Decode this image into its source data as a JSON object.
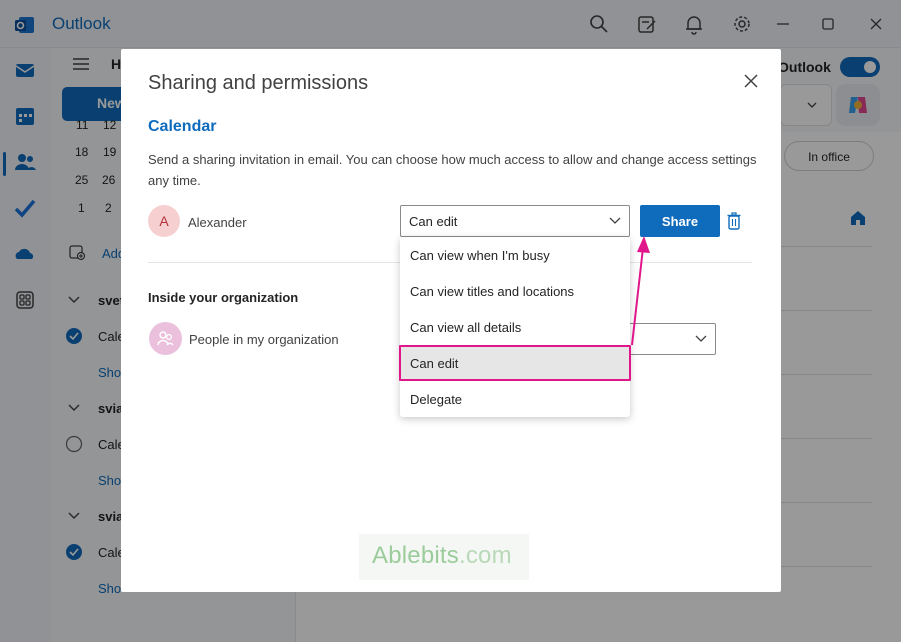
{
  "app": {
    "name": "Outlook"
  },
  "ribbon": {
    "tab_home_partial": "H",
    "new_button_partial": "New",
    "toggle_label_partial": "Outlook",
    "in_office_label": "In office"
  },
  "mini_calendar": {
    "rows": [
      [
        "11",
        "12"
      ],
      [
        "18",
        "19"
      ],
      [
        "25",
        "26"
      ],
      [
        "1",
        "2"
      ]
    ]
  },
  "sidepane": {
    "add_partial": "Add",
    "groups": [
      {
        "header_partial": "svet",
        "calendar_partial": "Cale",
        "checked": true,
        "show_partial": "Sho"
      },
      {
        "header_partial": "svia",
        "calendar_partial": "Cale",
        "checked": false,
        "show_partial": "Sho"
      },
      {
        "header_partial": "svia",
        "calendar_partial": "Cale",
        "checked": true,
        "show_partial": "Sho"
      }
    ]
  },
  "dialog": {
    "title": "Sharing and permissions",
    "subtitle": "Calendar",
    "description": "Send a sharing invitation in email. You can choose how much access to allow and change access settings any time.",
    "invitee": {
      "initial": "A",
      "name": "Alexander",
      "permission": "Can edit"
    },
    "share_button": "Share",
    "section_title": "Inside your organization",
    "organization": {
      "name": "People in my organization"
    },
    "permission_options": [
      "Can view when I'm busy",
      "Can view titles and locations",
      "Can view all details",
      "Can edit",
      "Delegate"
    ],
    "selected_option": "Can edit"
  },
  "watermark": {
    "brand": "Ablebits",
    "suffix": ".com"
  },
  "colors": {
    "accent": "#0f6cbd",
    "highlight": "#e0168a",
    "avatar_a_bg": "#f6d0d1",
    "avatar_org_bg": "#ebc0dd"
  }
}
